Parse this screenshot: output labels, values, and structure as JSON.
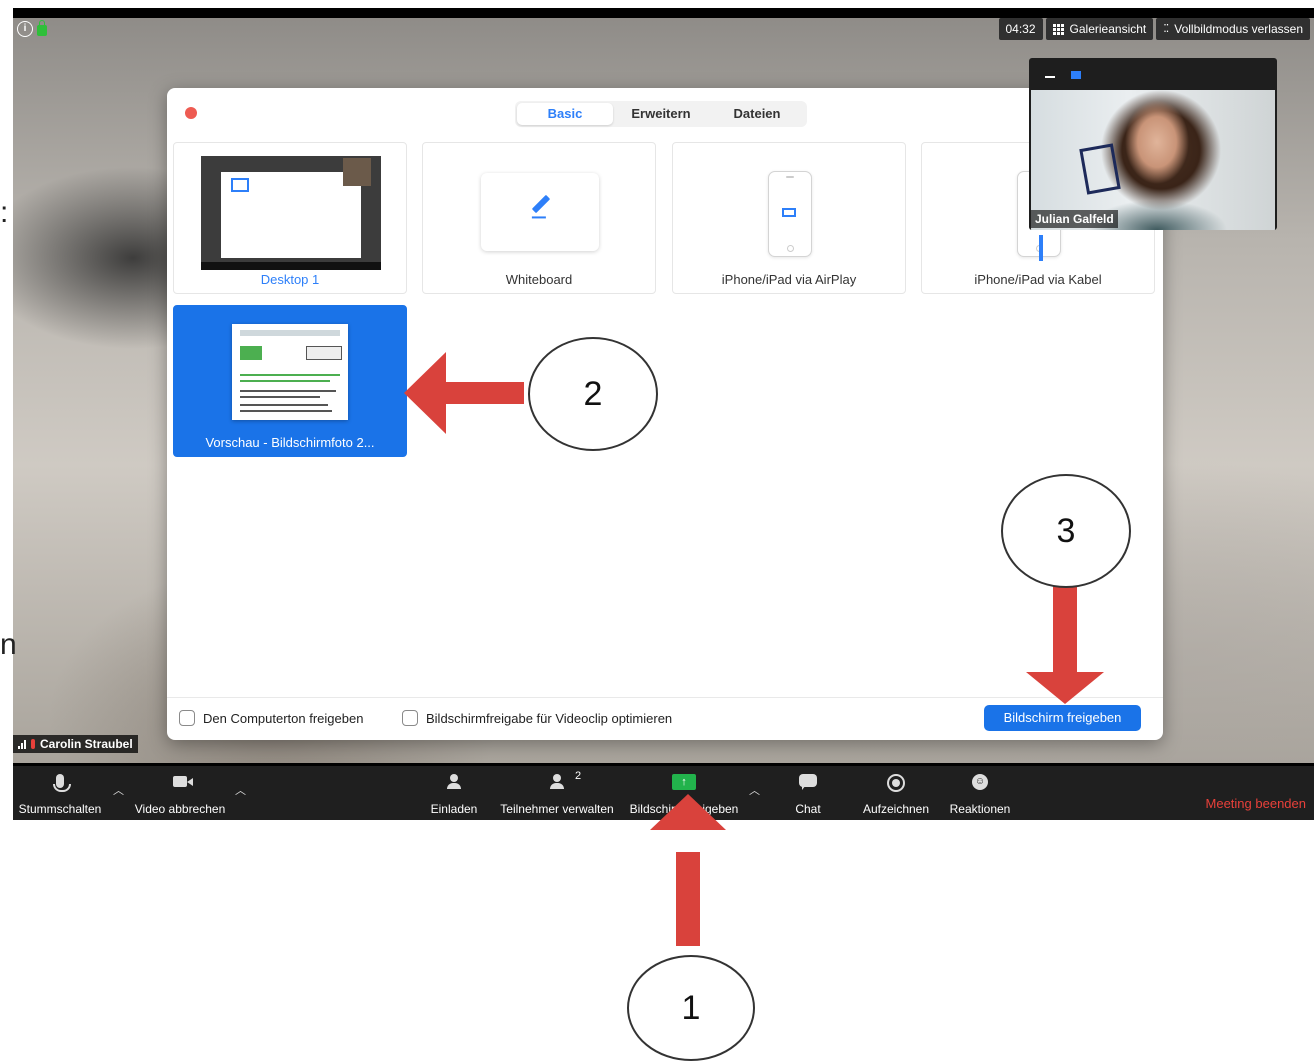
{
  "topbar": {
    "timer": "04:32",
    "gallery_label": "Galerieansicht",
    "fullscreen_label": "Vollbildmodus verlassen"
  },
  "dialog": {
    "tabs": [
      {
        "label": "Basic",
        "active": true
      },
      {
        "label": "Erweitern",
        "active": false
      },
      {
        "label": "Dateien",
        "active": false
      }
    ],
    "tiles": {
      "desktop": "Desktop 1",
      "whiteboard": "Whiteboard",
      "airplay": "iPhone/iPad via AirPlay",
      "kabel": "iPhone/iPad via Kabel",
      "preview": "Vorschau - Bildschirmfoto 2..."
    },
    "checkbox_sound": "Den Computerton freigeben",
    "checkbox_video": "Bildschirmfreigabe für Videoclip optimieren",
    "share_button": "Bildschirm freigeben"
  },
  "self_view": {
    "name": "Julian Galfeld"
  },
  "participant": {
    "name": "Carolin Straubel"
  },
  "toolbar": {
    "mute": "Stummschalten",
    "video": "Video abbrechen",
    "invite": "Einladen",
    "participants": "Teilnehmer verwalten",
    "participants_count": "2",
    "share": "Bildschirm freigeben",
    "chat": "Chat",
    "record": "Aufzeichnen",
    "reactions": "Reaktionen",
    "end": "Meeting beenden"
  },
  "annotations": {
    "step1": "1",
    "step2": "2",
    "step3": "3",
    "edge_left_top": ":",
    "edge_left_bottom": "n"
  },
  "colors": {
    "accent": "#1a73e8",
    "share_green": "#22b34c",
    "end_red": "#e8403a",
    "arrow_red": "#d9423c"
  }
}
